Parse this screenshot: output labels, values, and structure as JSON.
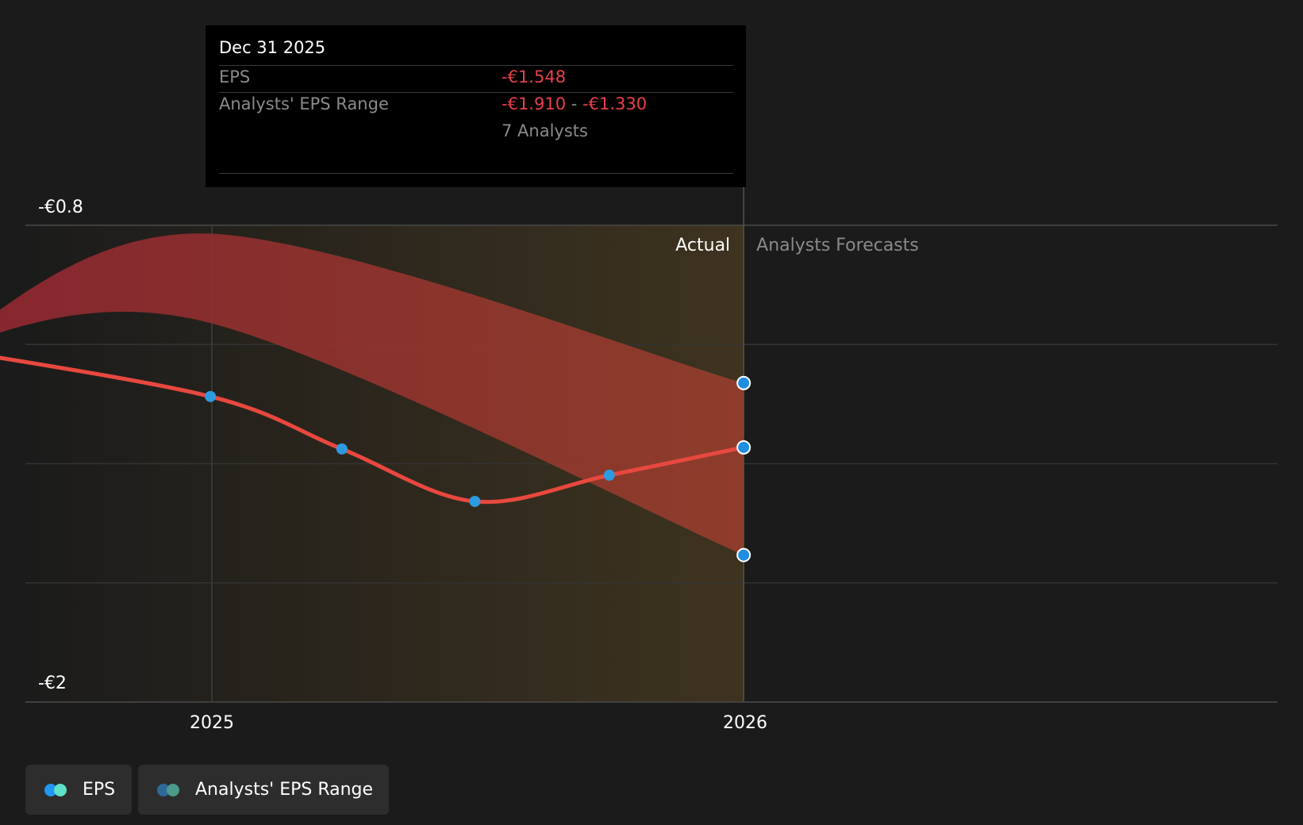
{
  "chart_data": {
    "type": "line",
    "y_tick_labels": [
      "-€0.8",
      "-€2"
    ],
    "ylim": [
      -2.0,
      -0.8
    ],
    "x_tick_labels": [
      "2025",
      "2026"
    ],
    "actual_label": "Actual",
    "forecast_label": "Analysts Forecasts",
    "grid": true,
    "legend_position": "bottom-left",
    "series": [
      {
        "name": "EPS",
        "color": "#e8483f",
        "points": [
          {
            "x": "2024-06-30",
            "y": -1.109
          },
          {
            "x": "2024-12-31",
            "y": -1.231
          },
          {
            "x": "2025-03-31",
            "y": -1.363
          },
          {
            "x": "2025-06-30",
            "y": -1.495
          },
          {
            "x": "2025-09-30",
            "y": -1.429
          },
          {
            "x": "2025-12-31",
            "y": -1.359
          }
        ]
      }
    ],
    "range": {
      "name": "Analysts' EPS Range",
      "color": "#a23333",
      "upper": [
        {
          "x": "2024-06-30",
          "y": -1.109
        },
        {
          "x": "2024-12-31",
          "y": -0.821
        },
        {
          "x": "2025-12-31",
          "y": -1.197
        }
      ],
      "lower": [
        {
          "x": "2024-06-30",
          "y": -1.109
        },
        {
          "x": "2024-12-31",
          "y": -1.046
        },
        {
          "x": "2025-12-31",
          "y": -1.63
        }
      ]
    }
  },
  "tooltip": {
    "date": "Dec 31 2025",
    "eps_label": "EPS",
    "eps_value": "-€1.548",
    "range_label": "Analysts' EPS Range",
    "range_low": "-€1.910",
    "range_sep": "-",
    "range_high": "-€1.330",
    "analysts": "7 Analysts"
  },
  "legend": {
    "items": [
      {
        "label": "EPS",
        "dot_colors": [
          "#2196f3",
          "#5fe0c8"
        ]
      },
      {
        "label": "Analysts' EPS Range",
        "dot_colors": [
          "#2d6a9a",
          "#4c9a8a"
        ]
      }
    ]
  },
  "colors": {
    "background": "#1b1b1b",
    "eps_line": "#e8483f",
    "point": "#2d9be0",
    "negative_value": "#e8404a",
    "actual_shade": "#3e331f"
  }
}
